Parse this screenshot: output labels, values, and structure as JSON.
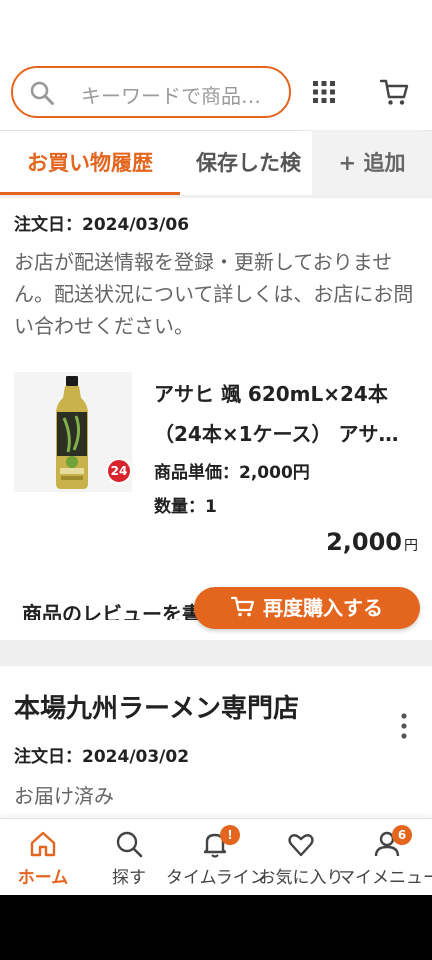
{
  "header": {
    "search_placeholder": "キーワードで商品…"
  },
  "tabs": {
    "items": [
      {
        "label": "お買い物履歴",
        "active": true
      },
      {
        "label": "保存した検"
      }
    ],
    "add_label": "+ 追加"
  },
  "orders": [
    {
      "date": "注文日：2024/03/06",
      "notice": "お店が配送情報を登録・更新しておりません。配送状況について詳しくは、お店にお問い合わせください。",
      "product": {
        "title_line1": "アサヒ 颯 620mL×24本",
        "title_line2": "（24本×1ケース） アサ…",
        "unit_price": "商品単価：2,000円",
        "quantity": "数量：1",
        "badge": "24",
        "image_icon": "tea-bottle-image"
      },
      "total": "2,000",
      "total_unit": "円",
      "review_link": "商品のレビューを書く",
      "rebuy_label": "再度購入する"
    },
    {
      "shop_name": "本場九州ラーメン専門店",
      "date": "注文日：2024/03/02",
      "status": "お届け済み"
    }
  ],
  "bottom_nav": {
    "items": [
      {
        "label": "ホーム",
        "icon": "home-icon",
        "active": true
      },
      {
        "label": "探す",
        "icon": "search-icon"
      },
      {
        "label": "タイムライン",
        "icon": "bell-icon",
        "badge": "!"
      },
      {
        "label": "お気に入り",
        "icon": "heart-icon"
      },
      {
        "label": "マイメニュー",
        "icon": "user-icon",
        "badge": "6"
      }
    ]
  },
  "colors": {
    "accent": "#e4661e",
    "text": "#222222",
    "muted": "#666666"
  }
}
